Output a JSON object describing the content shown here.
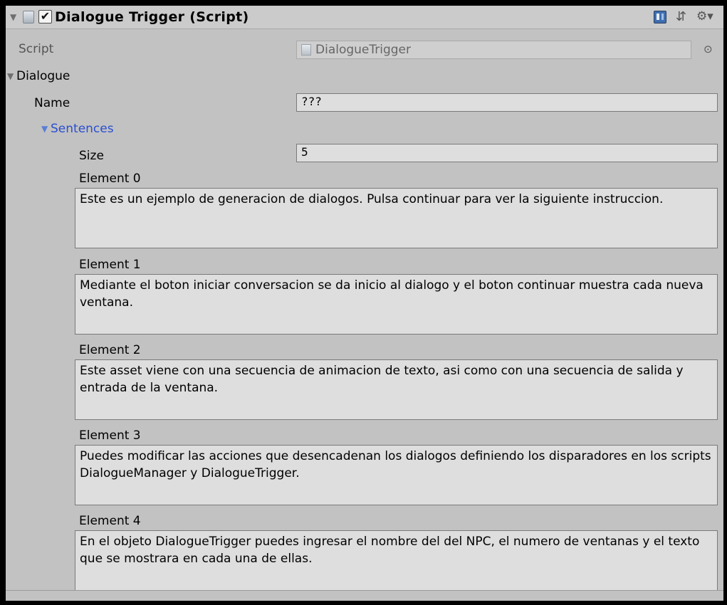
{
  "component": {
    "title": "Dialogue Trigger (Script)",
    "enabled": true,
    "check_glyph": "✔",
    "fold_glyph": "▼",
    "help_icon": "book-icon",
    "presets_icon": "sliders-icon",
    "settings_icon": "gear-icon"
  },
  "script_row": {
    "label": "Script",
    "value": "DialogueTrigger",
    "target_glyph": "⊙"
  },
  "dialogue": {
    "label": "Dialogue",
    "name_label": "Name",
    "name_value": "???",
    "sentences": {
      "label": "Sentences",
      "size_label": "Size",
      "size_value": "5",
      "elements": [
        {
          "label": "Element 0",
          "text": "Este es un ejemplo de generacion de dialogos. Pulsa continuar para ver la siguiente instruccion."
        },
        {
          "label": "Element 1",
          "text": "Mediante el boton iniciar conversacion se da inicio al dialogo y el boton continuar muestra cada nueva ventana."
        },
        {
          "label": "Element 2",
          "text": "Este asset viene con una secuencia de animacion de texto, asi como con una secuencia de salida y entrada de la ventana."
        },
        {
          "label": "Element 3",
          "text": "Puedes modificar las acciones que desencadenan los dialogos definiendo los disparadores en los scripts DialogueManager y DialogueTrigger."
        },
        {
          "label": "Element 4",
          "text": "En el objeto DialogueTrigger puedes ingresar el nombre del del NPC, el numero de ventanas y el texto que se mostrara en cada una de ellas."
        }
      ]
    }
  }
}
